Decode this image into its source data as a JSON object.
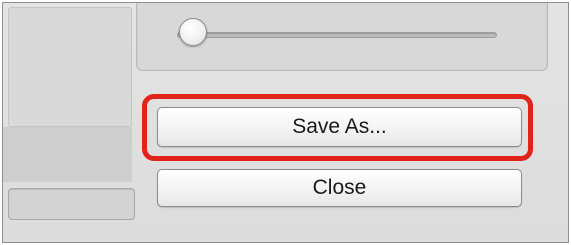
{
  "buttons": {
    "save_as_label": "Save As...",
    "close_label": "Close"
  },
  "slider": {
    "value_fraction": 0.0
  },
  "colors": {
    "highlight": "#e2231a",
    "window_bg": "#dedede"
  }
}
